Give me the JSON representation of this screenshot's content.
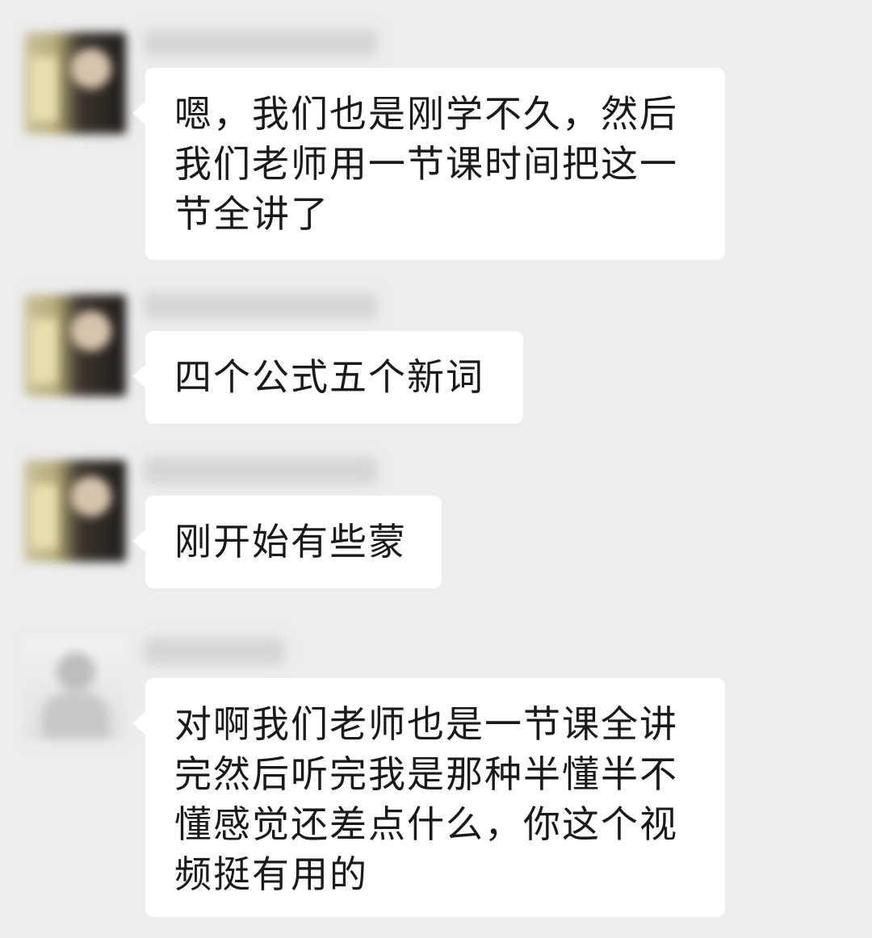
{
  "messages": [
    {
      "avatar_icon": "avatar-photo-icon",
      "text": "嗯，我们也是刚学不久，然后我们老师用一节课时间把这一节全讲了"
    },
    {
      "avatar_icon": "avatar-photo-icon",
      "text": "四个公式五个新词"
    },
    {
      "avatar_icon": "avatar-photo-icon",
      "text": "刚开始有些蒙"
    },
    {
      "avatar_icon": "avatar-photo-icon",
      "text": "对啊我们老师也是一节课全讲完然后听完我是那种半懂半不懂感觉还差点什么，你这个视频挺有用的"
    }
  ],
  "colors": {
    "background": "#ededed",
    "bubble": "#ffffff",
    "text": "#1a1a1a"
  }
}
